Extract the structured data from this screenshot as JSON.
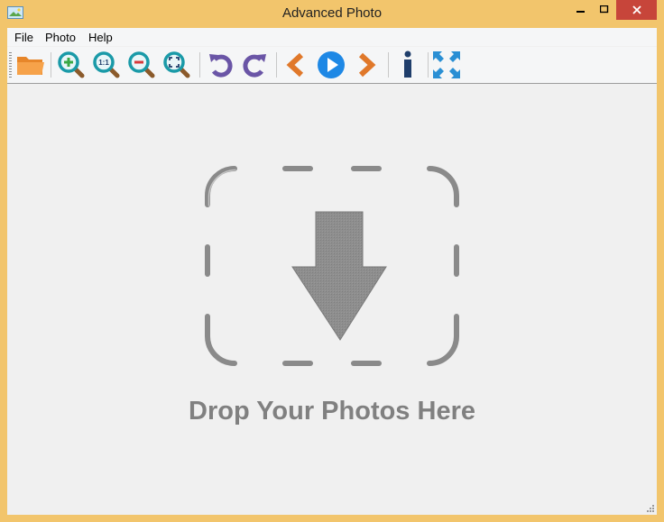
{
  "window": {
    "title": "Advanced Photo"
  },
  "menu": {
    "items": [
      "File",
      "Photo",
      "Help"
    ]
  },
  "toolbar": {
    "buttons": [
      {
        "icon": "open-folder-icon"
      },
      {
        "icon": "zoom-in-icon"
      },
      {
        "icon": "zoom-actual-size-icon",
        "text": "1:1"
      },
      {
        "icon": "zoom-out-icon"
      },
      {
        "icon": "zoom-fit-icon"
      },
      {
        "icon": "rotate-left-icon"
      },
      {
        "icon": "rotate-right-icon"
      },
      {
        "icon": "previous-icon"
      },
      {
        "icon": "play-slideshow-icon"
      },
      {
        "icon": "next-icon"
      },
      {
        "icon": "info-icon"
      },
      {
        "icon": "fullscreen-icon"
      }
    ]
  },
  "drop_zone": {
    "text": "Drop Your Photos Here"
  },
  "colors": {
    "title_bar": "#f2c56c",
    "close_button": "#c7453a",
    "zoom_teal": "#1a9aa8",
    "rotate_purple": "#6a55a6",
    "nav_orange": "#e0782a",
    "play_blue": "#1e88e5",
    "info_navy": "#1f3e6b",
    "fullscreen_blue": "#2a8fd4",
    "drop_gray": "#808080"
  }
}
